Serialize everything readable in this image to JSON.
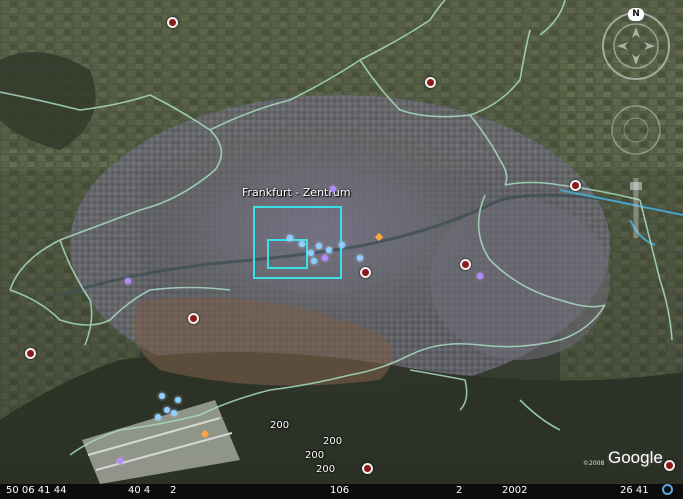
{
  "map": {
    "place_label": "Frankfurt - Zentrum",
    "overlay_numbers": [
      "200",
      "200",
      "200",
      "200"
    ],
    "colors": {
      "boundary": "#a8dcc0",
      "river": "#4aa3c4",
      "zone_outline": "#38e0e8",
      "marker_red": "#8b1a1a"
    }
  },
  "status_bar": {
    "coord_lat": "50 06 41 44",
    "field_2": "40 4",
    "field_3": "2",
    "field_4": "106",
    "field_5": "2",
    "year": "2002",
    "coord_lon": "26 41"
  },
  "branding": {
    "logo": "Google",
    "copyright": "©2008"
  },
  "navigation": {
    "north_label": "N",
    "icons": [
      "compass-ring-icon",
      "look-joystick-icon",
      "move-joystick-icon",
      "zoom-slider-icon"
    ]
  }
}
